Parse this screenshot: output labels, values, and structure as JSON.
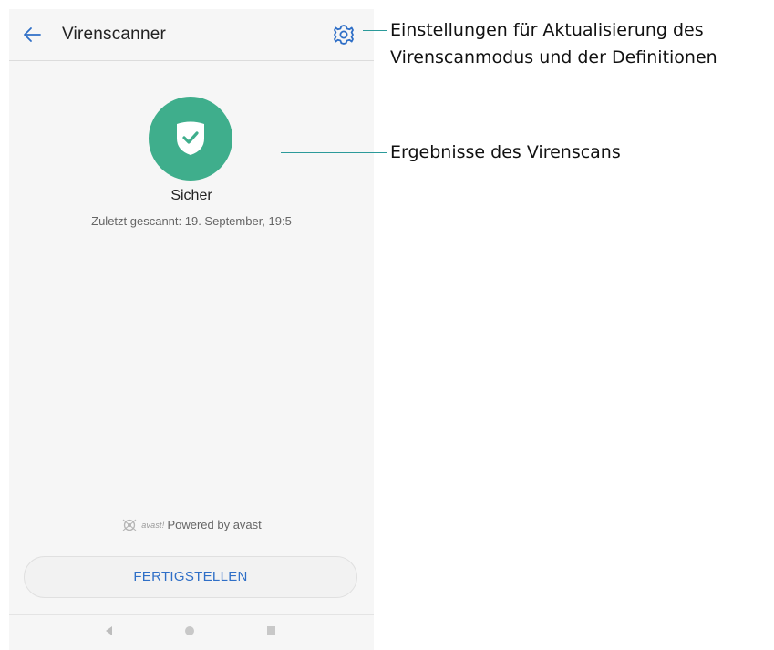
{
  "screen": {
    "title": "Virenscanner",
    "status_label": "Sicher",
    "last_scan": "Zuletzt gescannt: 19. September, 19:5",
    "powered_logo_text": "avast!",
    "powered_by": "Powered by avast",
    "finish_button": "FERTIGSTELLEN",
    "icons": {
      "back": "back-arrow-icon",
      "settings": "gear-icon",
      "status": "shield-check-icon",
      "avast_logo": "avast-logo-icon",
      "nav_back": "nav-back-icon",
      "nav_home": "nav-home-icon",
      "nav_recent": "nav-recent-icon"
    }
  },
  "callouts": {
    "settings_line1": "Einstellungen für Aktualisierung des",
    "settings_line2": "Virenscanmodus und der Definitionen",
    "results": "Ergebnisse des Virenscans"
  },
  "colors": {
    "accent_blue": "#2f6fc7",
    "status_green": "#3fae8c",
    "callout_line": "#2b9a9a"
  }
}
